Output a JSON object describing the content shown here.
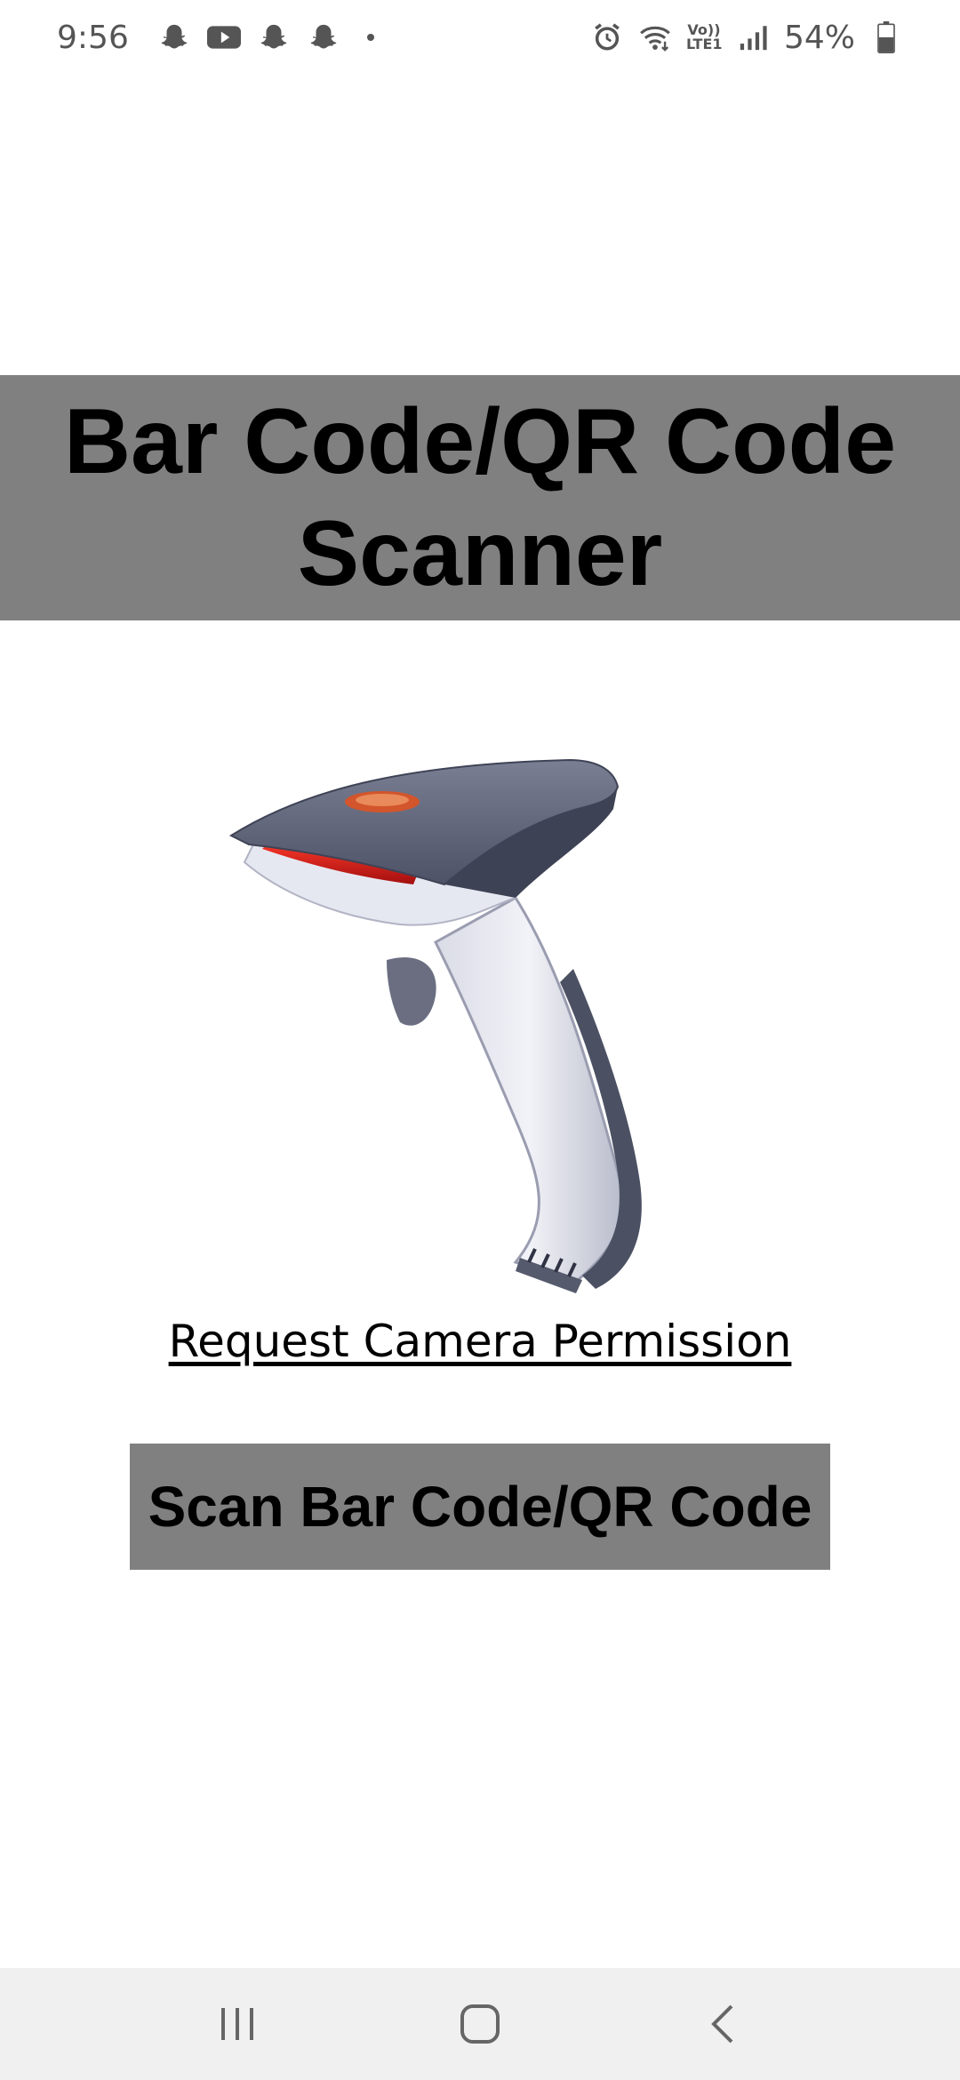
{
  "status_bar": {
    "time": "9:56",
    "battery": "54%",
    "left_icons": [
      "snapchat-icon",
      "youtube-icon",
      "snapchat-icon",
      "snapchat-icon"
    ],
    "right_icons": [
      "alarm-icon",
      "wifi-icon",
      "volte-lte-icon",
      "signal-icon",
      "battery-icon"
    ],
    "lte_label": "Vo)) LTE1"
  },
  "header": {
    "title": "Bar Code/QR Code Scanner",
    "background": "#808080"
  },
  "illustration": {
    "icon": "barcode-scanner-gun-icon"
  },
  "permission": {
    "label": "Request Camera Permission"
  },
  "scan_button": {
    "label": "Scan Bar Code/QR Code",
    "background": "#808080"
  },
  "nav_bar": {
    "icons": [
      "recent-apps-icon",
      "home-icon",
      "back-icon"
    ]
  }
}
